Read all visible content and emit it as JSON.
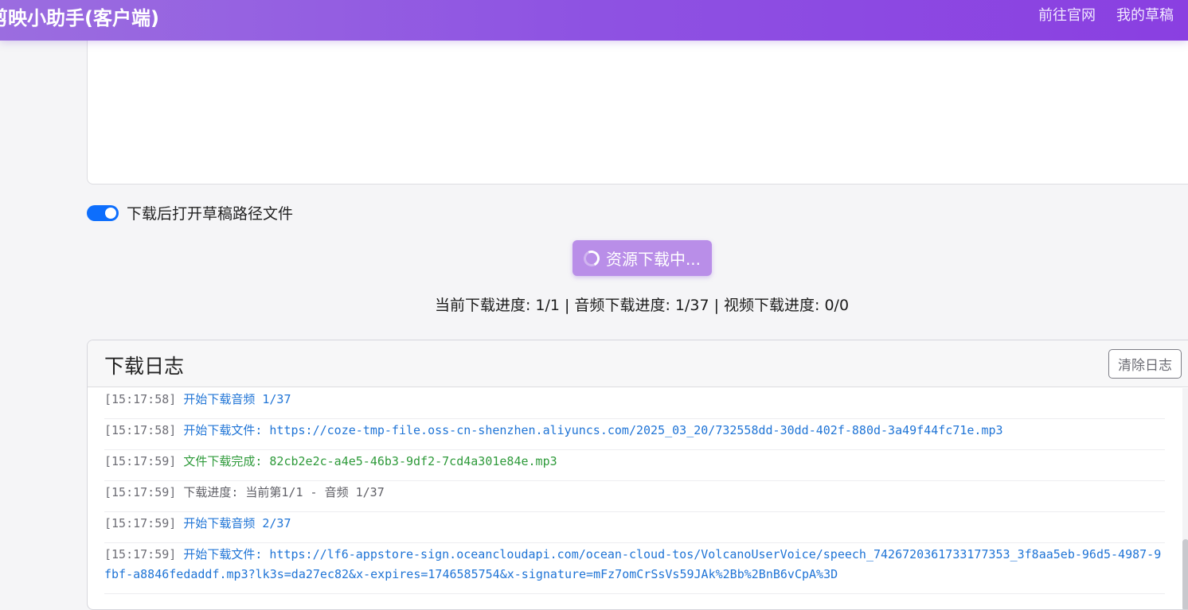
{
  "header": {
    "title": "剪映小助手(客户端)",
    "nav": [
      "前往官网",
      "我的草稿"
    ]
  },
  "options": {
    "open_after_download_label": "下载后打开草稿路径文件",
    "open_after_download_enabled": true
  },
  "download_button": {
    "label": "资源下载中..."
  },
  "progress": {
    "text": "当前下载进度: 1/1 | 音频下载进度: 1/37 | 视频下载进度: 0/0"
  },
  "log": {
    "title": "下载日志",
    "clear_label": "清除日志",
    "entries": [
      {
        "time": "[15:17:58]",
        "message": "开始下载音频 1/37",
        "level": "info"
      },
      {
        "time": "[15:17:58]",
        "message": "开始下载文件: https://coze-tmp-file.oss-cn-shenzhen.aliyuncs.com/2025_03_20/732558dd-30dd-402f-880d-3a49f44fc71e.mp3",
        "level": "info"
      },
      {
        "time": "[15:17:59]",
        "message": "文件下载完成: 82cb2e2c-a4e5-46b3-9df2-7cd4a301e84e.mp3",
        "level": "success"
      },
      {
        "time": "[15:17:59]",
        "message": "下载进度: 当前第1/1 - 音频 1/37",
        "level": "neutral"
      },
      {
        "time": "[15:17:59]",
        "message": "开始下载音频 2/37",
        "level": "info"
      },
      {
        "time": "[15:17:59]",
        "message": "开始下载文件: https://lf6-appstore-sign.oceancloudapi.com/ocean-cloud-tos/VolcanoUserVoice/speech_7426720361733177353_3f8aa5eb-96d5-4987-9fbf-a8846fedaddf.mp3?lk3s=da27ec82&x-expires=1746585754&x-signature=mFz7omCrSsVs59JAk%2Bb%2BnB6vCpA%3D",
        "level": "info"
      }
    ]
  },
  "colors": {
    "header_gradient_start": "#9b6de0",
    "header_gradient_end": "#8a3fe1",
    "toggle_on": "#0d6efd",
    "button_bg": "#b98ee8",
    "log_info": "#1f74d6",
    "log_success": "#2e9a3a"
  }
}
